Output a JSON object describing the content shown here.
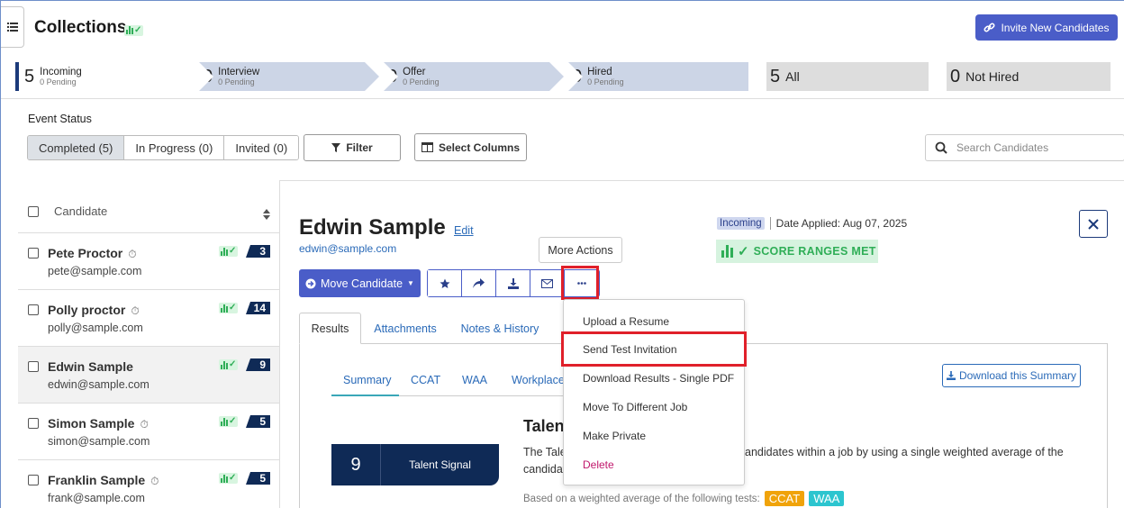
{
  "header": {
    "title": "Collections",
    "invite_label": "Invite New Candidates"
  },
  "stages": [
    {
      "count": "5",
      "label": "Incoming",
      "sub": "0 Pending"
    },
    {
      "count": "0",
      "label": "Interview",
      "sub": "0 Pending"
    },
    {
      "count": "0",
      "label": "Offer",
      "sub": "0 Pending"
    },
    {
      "count": "0",
      "label": "Hired",
      "sub": "0 Pending"
    },
    {
      "count": "5",
      "label": "All"
    },
    {
      "count": "0",
      "label": "Not Hired"
    }
  ],
  "filters": {
    "event_status_label": "Event Status",
    "segments": [
      "Completed (5)",
      "In Progress (0)",
      "Invited (0)"
    ],
    "filter_label": "Filter",
    "select_columns_label": "Select Columns",
    "search_placeholder": "Search Candidates"
  },
  "list": {
    "header": "Candidate",
    "candidates": [
      {
        "name": "Pete Proctor",
        "email": "pete@sample.com",
        "count": "3"
      },
      {
        "name": "Polly proctor",
        "email": "polly@sample.com",
        "count": "14"
      },
      {
        "name": "Edwin Sample",
        "email": "edwin@sample.com",
        "count": "9"
      },
      {
        "name": "Simon Sample",
        "email": "simon@sample.com",
        "count": "5"
      },
      {
        "name": "Franklin Sample",
        "email": "frank@sample.com",
        "count": "5"
      }
    ]
  },
  "detail": {
    "name": "Edwin Sample",
    "edit": "Edit",
    "email": "edwin@sample.com",
    "stage_badge": "Incoming",
    "date_applied": "Date Applied: Aug 07, 2025",
    "score_label": "SCORE RANGES MET",
    "move_label": "Move Candidate",
    "tooltip": "More Actions",
    "tabs": [
      "Results",
      "Attachments",
      "Notes & History"
    ],
    "subtabs": [
      "Summary",
      "CCAT",
      "WAA",
      "Workplace"
    ],
    "download_summary": "Download this Summary",
    "section_title": "Talent",
    "desc_left": "The Tale",
    "desc_left2": "candidat",
    "desc_right": "andidates within a job by using a single weighted average of the",
    "ts_number": "9",
    "ts_label": "Talent Signal",
    "based_on": "Based on a weighted average of the following tests:",
    "test_tags": [
      "CCAT",
      "WAA"
    ]
  },
  "menu": {
    "items": [
      "Upload a Resume",
      "Send Test Invitation",
      "Download Results - Single PDF",
      "Move To Different Job",
      "Make Private",
      "Delete"
    ]
  },
  "colors": {
    "primary": "#4a5dc8",
    "navy": "#0f2a56",
    "highlight": "#e0202a",
    "success": "#2fae57",
    "delete": "#c0186c",
    "ccat": "#f0a30a",
    "waa": "#2cc5cf"
  }
}
